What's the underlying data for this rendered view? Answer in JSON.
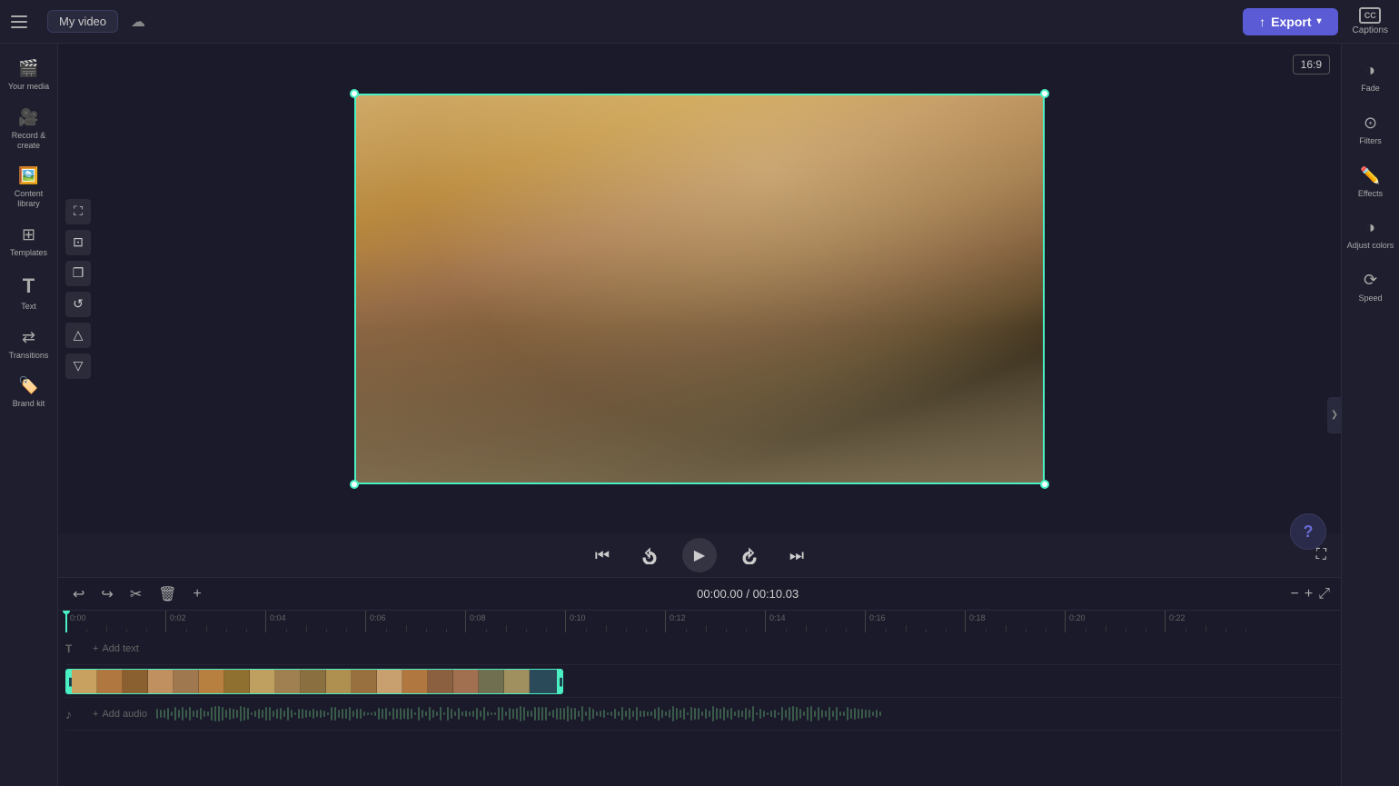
{
  "app": {
    "title": "My video",
    "aspect_ratio": "16:9",
    "current_time": "00:00.00",
    "total_time": "00:10.03"
  },
  "topbar": {
    "menu_icon_label": "Menu",
    "title": "My video",
    "cloud_icon_label": "Save to cloud",
    "export_label": "Export",
    "captions_label": "Captions"
  },
  "left_sidebar": {
    "items": [
      {
        "id": "your-media",
        "label": "Your media",
        "icon": "🎬"
      },
      {
        "id": "record-create",
        "label": "Record & create",
        "icon": "🎥"
      },
      {
        "id": "content-library",
        "label": "Content library",
        "icon": "🖼️"
      },
      {
        "id": "templates",
        "label": "Templates",
        "icon": "⊞"
      },
      {
        "id": "text",
        "label": "Text",
        "icon": "T"
      },
      {
        "id": "transitions",
        "label": "Transitions",
        "icon": "⇄"
      },
      {
        "id": "brand-kit",
        "label": "Brand kit",
        "icon": "🏷️"
      }
    ]
  },
  "right_sidebar": {
    "items": [
      {
        "id": "fade",
        "label": "Fade",
        "icon": "◑"
      },
      {
        "id": "filters",
        "label": "Filters",
        "icon": "⊙"
      },
      {
        "id": "effects",
        "label": "Effects",
        "icon": "✏️"
      },
      {
        "id": "adjust-colors",
        "label": "Adjust colors",
        "icon": "◑"
      },
      {
        "id": "speed",
        "label": "Speed",
        "icon": "⟳"
      }
    ],
    "collapse_icon": "❯"
  },
  "left_tools": [
    {
      "id": "fullscreen-tool",
      "icon": "⛶"
    },
    {
      "id": "crop-tool",
      "icon": "⊡"
    },
    {
      "id": "clone-tool",
      "icon": "❐"
    },
    {
      "id": "rotate-tool",
      "icon": "↺"
    },
    {
      "id": "flip-h-tool",
      "icon": "△"
    },
    {
      "id": "flip-v-tool",
      "icon": "▽"
    }
  ],
  "playback": {
    "skip_back_label": "Skip to start",
    "rewind_label": "Rewind 5s",
    "play_label": "Play",
    "forward_label": "Forward 5s",
    "skip_end_label": "Skip to end",
    "fullscreen_label": "Fullscreen"
  },
  "timeline": {
    "undo_label": "Undo",
    "redo_label": "Redo",
    "cut_label": "Cut",
    "delete_label": "Delete",
    "add_label": "Add",
    "current_time": "00:00.00",
    "total_time": "00:10.03",
    "zoom_out_label": "Zoom out",
    "zoom_in_label": "Zoom in",
    "expand_label": "Expand",
    "ruler_marks": [
      "0:00",
      "0:02",
      "0:04",
      "0:06",
      "0:08",
      "0:10",
      "0:12",
      "0:14",
      "0:16",
      "0:18",
      "0:20",
      "0:22"
    ],
    "text_track_label": "Add text",
    "audio_track_label": "Add audio"
  }
}
